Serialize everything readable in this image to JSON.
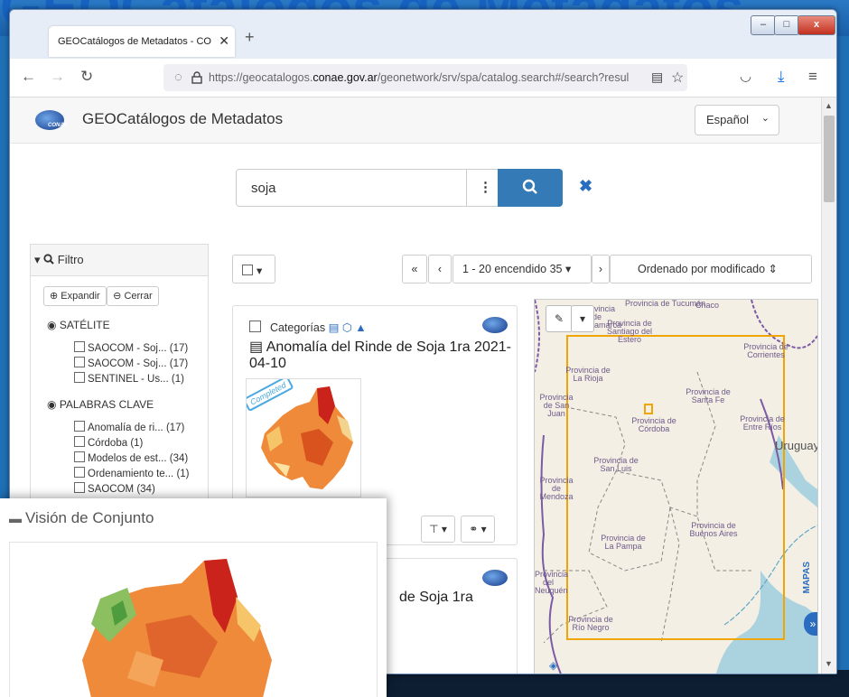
{
  "background": {
    "text": "GEOCatálogos de Metadatos"
  },
  "browser": {
    "tab_title": "GEOCatálogos de Metadatos - CONAE",
    "tab_close": "✕",
    "new_tab": "+",
    "win_min": "–",
    "win_max": "□",
    "win_close": "x",
    "url_prefix": "https://geocatalogos.",
    "url_host": "conae.gov.ar",
    "url_rest": "/geonetwork/srv/spa/catalog.search#/search?resultType=details"
  },
  "header": {
    "title": "GEOCatálogos de Metadatos",
    "logo_text": "CONAE",
    "language": "Español"
  },
  "search": {
    "query": "soja"
  },
  "filter": {
    "title": "Filtro",
    "expand": "Expandir",
    "collapse": "Cerrar",
    "sections": [
      {
        "label": "SATÉLITE",
        "items": [
          {
            "label": "SAOCOM - Soj...",
            "count": "(17)"
          },
          {
            "label": "SAOCOM - Soj...",
            "count": "(17)"
          },
          {
            "label": "SENTINEL - Us...",
            "count": "(1)"
          }
        ]
      },
      {
        "label": "PALABRAS CLAVE",
        "items": [
          {
            "label": "Anomalía de ri...",
            "count": "(17)"
          },
          {
            "label": "Córdoba",
            "count": "(1)"
          },
          {
            "label": "Modelos de est...",
            "count": "(34)"
          },
          {
            "label": "Ordenamiento te...",
            "count": "(1)"
          },
          {
            "label": "SAOCOM",
            "count": "(34)"
          }
        ]
      }
    ]
  },
  "results": {
    "pagination": "1 - 20 encendido 35",
    "first": "«",
    "prev": "‹",
    "next": "›",
    "sort": "Ordenado por modificado",
    "card1": {
      "categories": "Categorías",
      "title": "Anomalía del Rinde de Soja 1ra 2021-04-10",
      "badge": "Completed"
    },
    "card2": {
      "title_fragment": "de Soja 1ra"
    }
  },
  "map": {
    "side_label": "MAPAS",
    "labels": [
      {
        "text": "Provincia de Tucumán"
      },
      {
        "text": "Chaco"
      },
      {
        "text": "Provincia de Santiago del Estero"
      },
      {
        "text": "Provincia de Corrientes"
      },
      {
        "text": "Provincia de La Rioja"
      },
      {
        "text": "Provincia de Santa Fe"
      },
      {
        "text": "Provincia de San Juan"
      },
      {
        "text": "Provincia de Córdoba"
      },
      {
        "text": "Provincia de Entre Ríos"
      },
      {
        "text": "Uruguay"
      },
      {
        "text": "Provincia de San Luis"
      },
      {
        "text": "Provincia de Mendoza"
      },
      {
        "text": "Provincia de Buenos Aires"
      },
      {
        "text": "Provincia de La Pampa"
      },
      {
        "text": "Provincia del Neuquén"
      },
      {
        "text": "Provincia de Río Negro"
      },
      {
        "text": "Provincia de Catamarca"
      }
    ]
  },
  "overlay": {
    "title": "Visión de Conjunto"
  },
  "colors": {
    "accent": "#337ab7",
    "map_extent": "#f0a500",
    "link": "#2a6cc0"
  }
}
